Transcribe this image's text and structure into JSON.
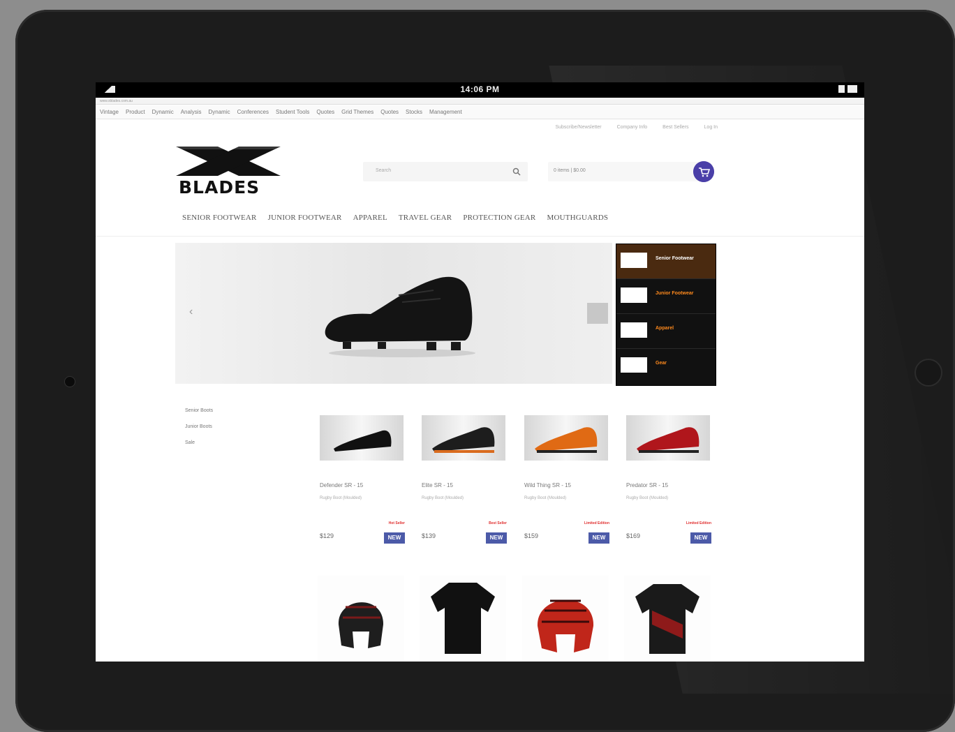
{
  "statusbar": {
    "time": "14:06 PM"
  },
  "browser": {
    "url": "www.xblades.com.au",
    "bookmarks": [
      "Vintage",
      "Product",
      "Dynamic",
      "Analysis",
      "Dynamic",
      "Conferences",
      "Student Tools",
      "Quotes",
      "Grid Themes",
      "Quotes",
      "Stocks",
      "Management"
    ]
  },
  "top_links": [
    "Subscribe/Newsletter",
    "Company Info",
    "Best Sellers",
    "Log In"
  ],
  "logo": {
    "wordmark": "BLADES"
  },
  "search": {
    "placeholder": "Search"
  },
  "cart": {
    "summary": "0 items | $0.00"
  },
  "nav": [
    "SENIOR FOOTWEAR",
    "JUNIOR FOOTWEAR",
    "APPAREL",
    "TRAVEL GEAR",
    "PROTECTION GEAR",
    "MOUTHGUARDS"
  ],
  "category_menu": [
    {
      "label": "Senior Footwear",
      "active": true
    },
    {
      "label": "Junior Footwear",
      "active": false
    },
    {
      "label": "Apparel",
      "active": false
    },
    {
      "label": "Gear",
      "active": false
    }
  ],
  "side_links": [
    "Senior Boots",
    "Junior Boots",
    "Sale"
  ],
  "products": [
    {
      "name": "Defender SR - 15",
      "sub": "Rugby Boot (Moulded)",
      "tag": "Hot Seller",
      "price": "$129",
      "badge": "NEW"
    },
    {
      "name": "Elite SR - 15",
      "sub": "Rugby Boot (Moulded)",
      "tag": "Best Seller",
      "price": "$139",
      "badge": "NEW"
    },
    {
      "name": "Wild Thing SR - 15",
      "sub": "Rugby Boot (Moulded)",
      "tag": "Limited Edition",
      "price": "$159",
      "badge": "NEW"
    },
    {
      "name": "Predator SR - 15",
      "sub": "Rugby Boot (Moulded)",
      "tag": "Limited Edition",
      "price": "$169",
      "badge": "NEW"
    }
  ],
  "colors": {
    "accent_blue": "#4c5aa8",
    "menu_orange": "#ff8a1d",
    "cart_purple": "#4a3fa8"
  }
}
